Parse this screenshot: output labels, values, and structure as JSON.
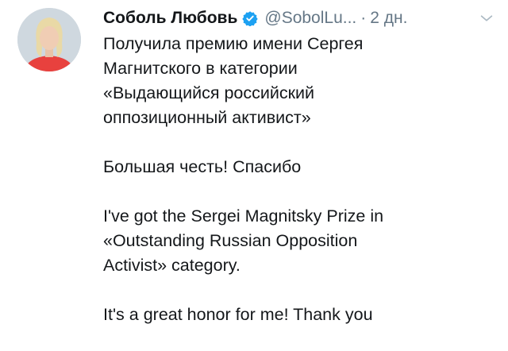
{
  "tweet": {
    "author_name": "Соболь Любовь",
    "author_handle": "@SobolLu...",
    "separator": "·",
    "timestamp": "2 дн.",
    "verified": true,
    "avatar_icon": "avatar-photo",
    "menu_icon": "chevron-down-icon",
    "paragraphs": [
      [
        "Получила премию имени Сергея",
        "Магнитского в категории",
        "«Выдающийся российский",
        "оппозиционный активист»"
      ],
      [
        "Большая честь! Спасибо"
      ],
      [
        "I've got the Sergei Magnitsky Prize in",
        "«Outstanding Russian Opposition",
        "Activist» category."
      ],
      [
        "It's a great honor for me! Thank you"
      ]
    ]
  },
  "colors": {
    "verified": "#1da1f2",
    "secondary_text": "#657786",
    "primary_text": "#14171a",
    "avatar_background": "#cfd8df",
    "avatar_shirt": "#e8413e"
  }
}
